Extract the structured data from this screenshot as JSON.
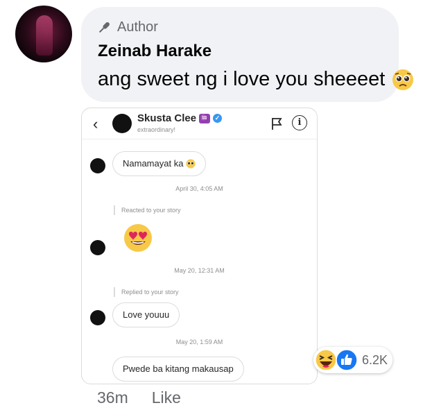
{
  "comment": {
    "badge_label": "Author",
    "author_name": "Zeinab Harake",
    "text": "ang sweet ng i love you sheeeet",
    "age": "36m",
    "like_label": "Like",
    "reaction_count": "6.2K"
  },
  "screenshot": {
    "profile_name": "Skusta Clee",
    "profile_sub": "extraordinary!",
    "messages": [
      {
        "text": "Namamayat ka",
        "timestamp": "April 30, 4:05 AM"
      },
      {
        "reply_note": "Reacted to your story",
        "timestamp": "May 20, 12:31 AM"
      },
      {
        "reply_note": "Replied to your story",
        "text": "Love youuu",
        "timestamp": "May 20, 1:59 AM"
      },
      {
        "text": "Pwede ba kitang makausap"
      }
    ]
  },
  "icons": {
    "badge": "microphone-icon",
    "emoji_pleading": "pleading-face-icon",
    "emoji_heart_eyes": "heart-eyes-icon",
    "reaction_haha": "haha-reaction-icon",
    "reaction_like": "like-reaction-icon",
    "aquarius": "aquarius-icon",
    "verified": "verified-badge-icon"
  },
  "colors": {
    "bubble_bg": "#f0f2f5",
    "secondary_text": "#65676b",
    "verified_blue": "#3897f0",
    "like_blue": "#1877f2"
  }
}
